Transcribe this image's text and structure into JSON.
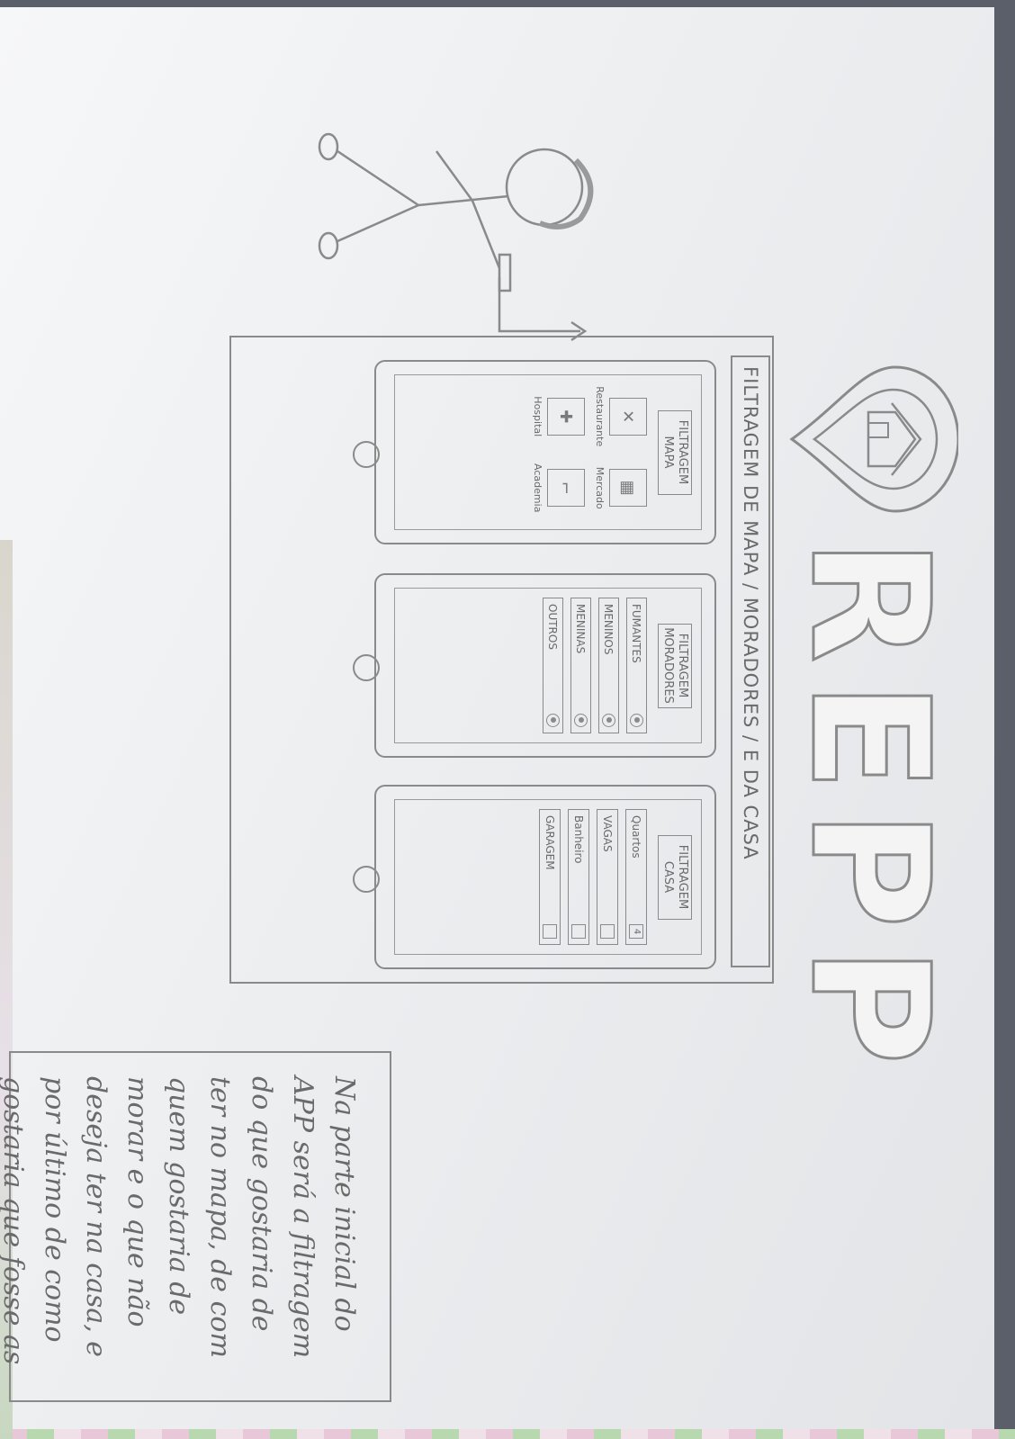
{
  "sketch": {
    "logo_word": "REPP",
    "banner_label": "FILTRAGEM DE MAPA / MORADORES / E DA CASA",
    "phones": [
      {
        "title": "FILTRAGEM MAPA",
        "items": [
          {
            "label": "Restaurante",
            "icon": "cutlery-icon",
            "glyph": "✕"
          },
          {
            "label": "Mercado",
            "icon": "cart-icon",
            "glyph": "▦"
          },
          {
            "label": "Hospital",
            "icon": "cross-icon",
            "glyph": "✚"
          },
          {
            "label": "Academia",
            "icon": "dumbbell-icon",
            "glyph": "⌐"
          }
        ]
      },
      {
        "title": "FILTRAGEM MORADORES",
        "options": [
          {
            "label": "FUMANTES"
          },
          {
            "label": "MENINOS"
          },
          {
            "label": "MENINAS"
          },
          {
            "label": "OUTROS"
          }
        ]
      },
      {
        "title": "FILTRAGEM CASA",
        "options": [
          {
            "label": "Quartos",
            "value": "4"
          },
          {
            "label": "VAGAS",
            "value": ""
          },
          {
            "label": "Banheiro",
            "value": ""
          },
          {
            "label": "GARAGEM",
            "value": ""
          }
        ]
      }
    ],
    "note": "Na parte inicial do APP será a filtragem do que gostaria de ter no mapa, de com quem gostaria de morar e o que não deseja ter na casa, e por último de como gostaria que fosse as casas apresentadas, ou seja, número de quartos, etc"
  }
}
